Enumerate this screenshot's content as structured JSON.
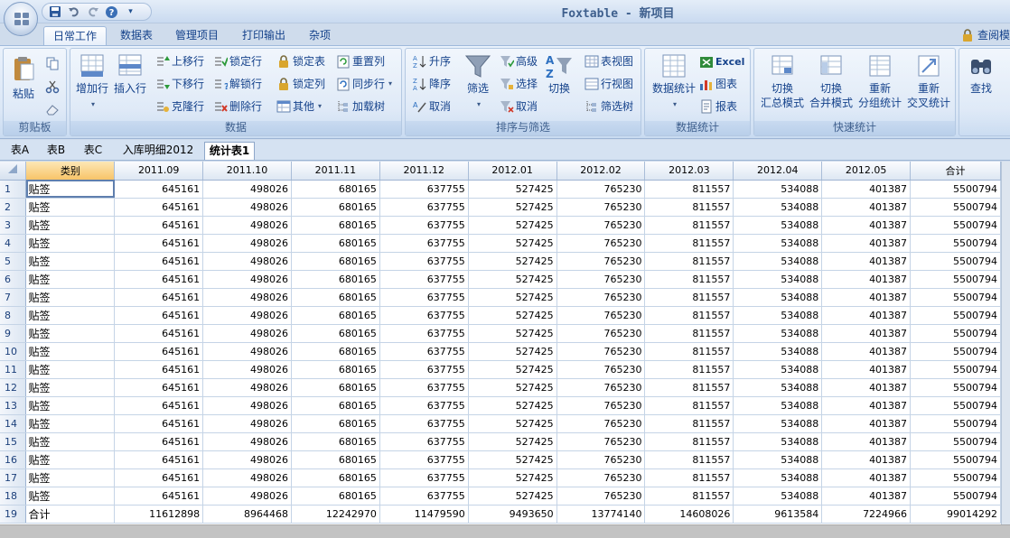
{
  "window": {
    "title": "Foxtable - 新项目"
  },
  "ribbon_tabs": [
    "日常工作",
    "数据表",
    "管理项目",
    "打印输出",
    "杂项"
  ],
  "active_ribbon_tab": 0,
  "help_link": "查阅模",
  "groups": {
    "clipboard": {
      "label": "剪贴板",
      "paste": "粘贴"
    },
    "data": {
      "label": "数据",
      "add_row": "增加行",
      "insert_row": "插入行",
      "move_up": "上移行",
      "move_down": "下移行",
      "clone_row": "克隆行",
      "lock_row": "锁定行",
      "unlock": "解锁行",
      "delete_row": "删除行",
      "lock_table": "锁定表",
      "lock_col": "锁定列",
      "other": "其他",
      "reset_col": "重置列",
      "sync_row": "同步行",
      "load_tree": "加载树"
    },
    "sort_filter": {
      "label": "排序与筛选",
      "asc": "升序",
      "desc": "降序",
      "cancel": "取消",
      "filter": "筛选",
      "advanced": "高级",
      "select": "选择",
      "cancel2": "取消",
      "toggle": "切换",
      "table_view": "表视图",
      "row_view": "行视图",
      "filter_tree": "筛选树"
    },
    "stats": {
      "label": "数据统计",
      "data_stats": "数据统计",
      "excel": "Excel",
      "chart": "图表",
      "report": "报表"
    },
    "quick": {
      "label": "快速统计",
      "b1a": "切换",
      "b1b": "汇总模式",
      "b2a": "切换",
      "b2b": "合并模式",
      "b3a": "重新",
      "b3b": "分组统计",
      "b4a": "重新",
      "b4b": "交叉统计"
    },
    "find": {
      "label": "查找"
    }
  },
  "sheet_tabs": [
    "表A",
    "表B",
    "表C",
    "入库明细2012",
    "统计表1"
  ],
  "active_sheet": 4,
  "table": {
    "columns": [
      "类别",
      "2011.09",
      "2011.10",
      "2011.11",
      "2011.12",
      "2012.01",
      "2012.02",
      "2012.03",
      "2012.04",
      "2012.05",
      "合计"
    ],
    "rows": [
      [
        "1",
        "贴签",
        "645161",
        "498026",
        "680165",
        "637755",
        "527425",
        "765230",
        "811557",
        "534088",
        "401387",
        "5500794"
      ],
      [
        "2",
        "贴签",
        "645161",
        "498026",
        "680165",
        "637755",
        "527425",
        "765230",
        "811557",
        "534088",
        "401387",
        "5500794"
      ],
      [
        "3",
        "贴签",
        "645161",
        "498026",
        "680165",
        "637755",
        "527425",
        "765230",
        "811557",
        "534088",
        "401387",
        "5500794"
      ],
      [
        "4",
        "贴签",
        "645161",
        "498026",
        "680165",
        "637755",
        "527425",
        "765230",
        "811557",
        "534088",
        "401387",
        "5500794"
      ],
      [
        "5",
        "贴签",
        "645161",
        "498026",
        "680165",
        "637755",
        "527425",
        "765230",
        "811557",
        "534088",
        "401387",
        "5500794"
      ],
      [
        "6",
        "贴签",
        "645161",
        "498026",
        "680165",
        "637755",
        "527425",
        "765230",
        "811557",
        "534088",
        "401387",
        "5500794"
      ],
      [
        "7",
        "贴签",
        "645161",
        "498026",
        "680165",
        "637755",
        "527425",
        "765230",
        "811557",
        "534088",
        "401387",
        "5500794"
      ],
      [
        "8",
        "贴签",
        "645161",
        "498026",
        "680165",
        "637755",
        "527425",
        "765230",
        "811557",
        "534088",
        "401387",
        "5500794"
      ],
      [
        "9",
        "贴签",
        "645161",
        "498026",
        "680165",
        "637755",
        "527425",
        "765230",
        "811557",
        "534088",
        "401387",
        "5500794"
      ],
      [
        "10",
        "贴签",
        "645161",
        "498026",
        "680165",
        "637755",
        "527425",
        "765230",
        "811557",
        "534088",
        "401387",
        "5500794"
      ],
      [
        "11",
        "贴签",
        "645161",
        "498026",
        "680165",
        "637755",
        "527425",
        "765230",
        "811557",
        "534088",
        "401387",
        "5500794"
      ],
      [
        "12",
        "贴签",
        "645161",
        "498026",
        "680165",
        "637755",
        "527425",
        "765230",
        "811557",
        "534088",
        "401387",
        "5500794"
      ],
      [
        "13",
        "贴签",
        "645161",
        "498026",
        "680165",
        "637755",
        "527425",
        "765230",
        "811557",
        "534088",
        "401387",
        "5500794"
      ],
      [
        "14",
        "贴签",
        "645161",
        "498026",
        "680165",
        "637755",
        "527425",
        "765230",
        "811557",
        "534088",
        "401387",
        "5500794"
      ],
      [
        "15",
        "贴签",
        "645161",
        "498026",
        "680165",
        "637755",
        "527425",
        "765230",
        "811557",
        "534088",
        "401387",
        "5500794"
      ],
      [
        "16",
        "贴签",
        "645161",
        "498026",
        "680165",
        "637755",
        "527425",
        "765230",
        "811557",
        "534088",
        "401387",
        "5500794"
      ],
      [
        "17",
        "贴签",
        "645161",
        "498026",
        "680165",
        "637755",
        "527425",
        "765230",
        "811557",
        "534088",
        "401387",
        "5500794"
      ],
      [
        "18",
        "贴签",
        "645161",
        "498026",
        "680165",
        "637755",
        "527425",
        "765230",
        "811557",
        "534088",
        "401387",
        "5500794"
      ],
      [
        "19",
        "合计",
        "11612898",
        "8964468",
        "12242970",
        "11479590",
        "9493650",
        "13774140",
        "14608026",
        "9613584",
        "7224966",
        "99014292"
      ]
    ]
  },
  "colors": {
    "accent": "#15428b",
    "ribbon": "#dbe7f6",
    "selected_header": "#f8c468"
  }
}
